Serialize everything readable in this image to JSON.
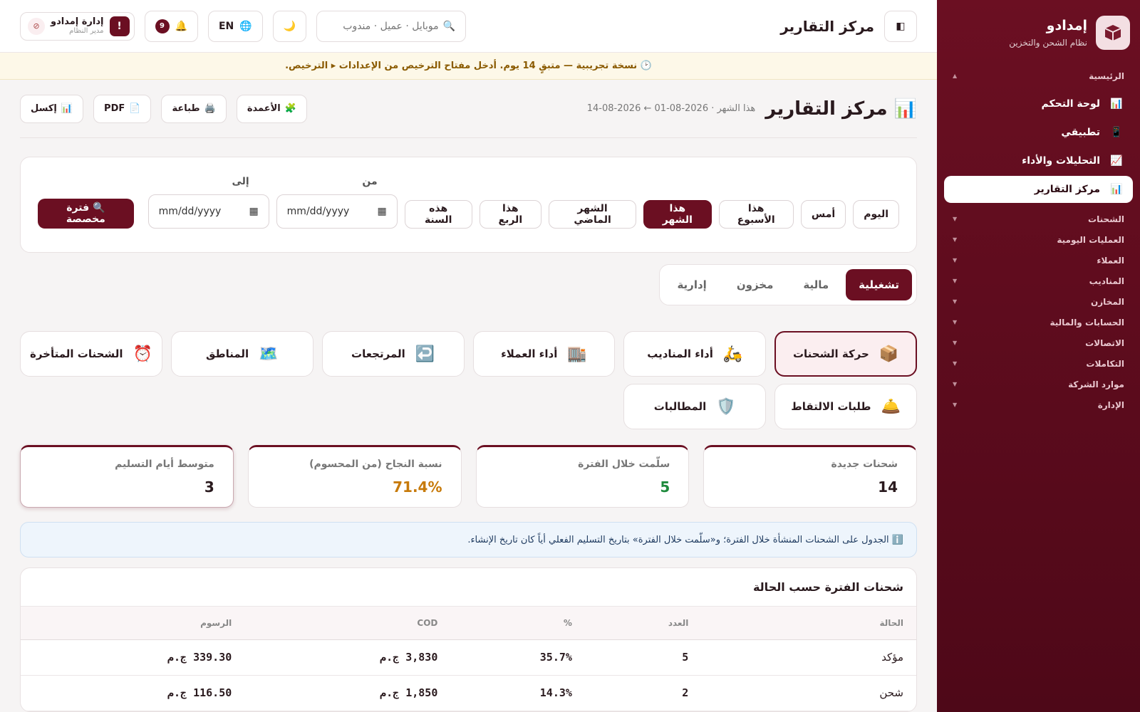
{
  "brand": {
    "name": "إمدادو",
    "subtitle": "نظام الشحن والتخزين"
  },
  "sidebar": {
    "home_section": "الرئيسية",
    "items": [
      {
        "icon": "📊",
        "label": "لوحة التحكم"
      },
      {
        "icon": "📱",
        "label": "تطبيقي"
      },
      {
        "icon": "📈",
        "label": "التحليلات والأداء"
      },
      {
        "icon": "📊",
        "label": "مركز التقارير"
      }
    ],
    "sections": [
      "الشحنات",
      "العمليات اليومية",
      "العملاء",
      "المناديب",
      "المخازن",
      "الحسابات والمالية",
      "الاتصالات",
      "التكاملات",
      "موارد الشركة",
      "الإدارة"
    ]
  },
  "topbar": {
    "title": "مركز التقارير",
    "search_placeholder": "موبايل · عميل · مندوب",
    "lang": "EN",
    "notif_count": "9",
    "user_name": "إدارة إمدادو",
    "user_role": "مدير النظام",
    "user_alert": "!"
  },
  "trial_banner": "🕑 نسخة تجريبية — متبقٍ 14 يوم. أدخل مفتاح الترخيص من الإعدادات ▸ الترخيص.",
  "page": {
    "title": "مركز التقارير",
    "range": "هذا الشهر · 2026-08-01 ← 2026-08-14",
    "actions": [
      {
        "icon": "📊",
        "label": "إكسل"
      },
      {
        "icon": "📄",
        "label": "PDF"
      },
      {
        "icon": "🖨️",
        "label": "طباعة"
      },
      {
        "icon": "🧩",
        "label": "الأعمدة"
      }
    ]
  },
  "filters": {
    "periods": [
      "اليوم",
      "أمس",
      "هذا الأسبوع",
      "هذا الشهر",
      "الشهر الماضي",
      "هذا الربع",
      "هذه السنة"
    ],
    "active_period": "هذا الشهر",
    "from_label": "من",
    "to_label": "إلى",
    "date_placeholder": "mm/dd/yyyy",
    "custom_button": "🔍 فترة مخصصة"
  },
  "tabs": [
    "تشغيلية",
    "مالية",
    "مخزون",
    "إدارية"
  ],
  "active_tab": "تشغيلية",
  "reports": [
    {
      "icon": "📦",
      "label": "حركة الشحنات"
    },
    {
      "icon": "🛵",
      "label": "أداء المناديب"
    },
    {
      "icon": "🏬",
      "label": "أداء العملاء"
    },
    {
      "icon": "↩️",
      "label": "المرتجعات"
    },
    {
      "icon": "🗺️",
      "label": "المناطق"
    },
    {
      "icon": "⏰",
      "label": "الشحنات المتأخرة"
    },
    {
      "icon": "🛎️",
      "label": "طلبات الالتقاط"
    },
    {
      "icon": "🛡️",
      "label": "المطالبات"
    }
  ],
  "stats": [
    {
      "label": "شحنات جديدة",
      "value": "14",
      "color": "#2a1a1e"
    },
    {
      "label": "سلّمت خلال الفترة",
      "value": "5",
      "color": "#1e8a3c"
    },
    {
      "label": "نسبة النجاح (من المحسوم)",
      "value": "71.4%",
      "color": "#c77a0a"
    },
    {
      "label": "متوسط أيام التسليم",
      "value": "3",
      "color": "#2a1a1e"
    }
  ],
  "info_note": "ℹ️ الجدول على الشحنات المنشأة خلال الفترة؛ و«سلّمت خلال الفترة» بتاريخ التسليم الفعلي أياً كان تاريخ الإنشاء.",
  "table": {
    "title": "شحنات الفترة حسب الحالة",
    "columns": [
      "الحالة",
      "العدد",
      "%",
      "COD",
      "الرسوم"
    ],
    "rows": [
      [
        "مؤكد",
        "5",
        "35.7%",
        "3,830 ج.م",
        "339.30 ج.م"
      ],
      [
        "شحن",
        "2",
        "14.3%",
        "1,850 ج.م",
        "116.50 ج.م"
      ]
    ]
  },
  "colors": {
    "accent": "#6b0f22",
    "sidebar_bg": "#5a0c1c"
  }
}
